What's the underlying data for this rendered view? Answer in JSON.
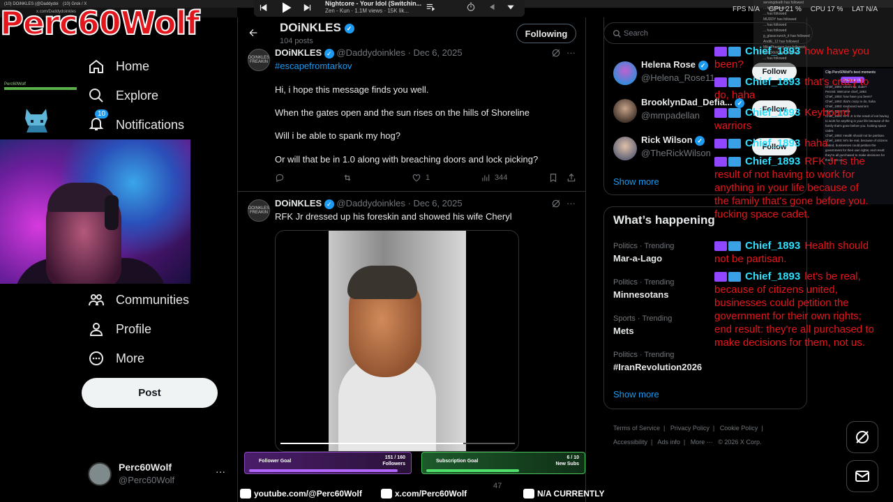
{
  "browser": {
    "tabs": [
      "(10) DOiNKLES (@Daddydoinkles)",
      "(10) Grok / X"
    ],
    "url": "x.com/Daddydoinkles"
  },
  "stream": {
    "logo_text": "Perc60Wolf",
    "mini_bar_label": "Perc60Wolf",
    "stats": [
      "FPS N/A",
      "GPU 21 %",
      "CPU 17 %",
      "LAT N/A"
    ],
    "events": [
      "servingdeath  has followed",
      "...  has followed",
      "...  has followed",
      "MUDDY  has followed",
      "...  has followed",
      "...  has followed",
      "g_glasscrunch_it  has followed",
      "AndiE_12  has followed",
      "MikePhantom  has followed",
      "SNICKER  has followed",
      "...  has followed"
    ],
    "clip_box": {
      "title": "Clip Perc60Wolf's best moments",
      "button": "Create a Clip",
      "lines": [
        "Chief_1893: what's up, dude?",
        "Perc60: Welcome chief_1893",
        "Chief_1893: how have you been?",
        "Chief_1893: that's crazy to do, haha",
        "Chief_1893: Keyboard warriors",
        "Chief_1893: haha",
        "Chief_1893: RFK Jr is the result of not having to work for anything in your life because of the family that's gone before you. fucking space cadet.",
        "Chief_1893: Health should not be partisan.",
        "Chief_1893: let's be real, because of citizens united, businesses could petition the government for their own rights; end result: they're all purchased to make decisions for them, not us."
      ]
    },
    "chat": [
      {
        "user": "Chief_1893",
        "msg": "how have you been?"
      },
      {
        "user": "Chief_1893",
        "msg": "that's crazy to do, haha"
      },
      {
        "user": "Chief_1893",
        "msg": "Keyboard warriors"
      },
      {
        "user": "Chief_1893",
        "msg": "haha"
      },
      {
        "user": "Chief_1893",
        "msg": "RFK Jr is the result of not having to work for anything in your life because of the family that's gone before you. fucking space cadet."
      },
      {
        "user": "Chief_1893",
        "msg": "Health should not be partisan."
      },
      {
        "user": "Chief_1893",
        "msg": "let's be real, because of citizens united, businesses could petition the government for their own rights; end result: they're all purchased to make decisions for them, not us."
      }
    ],
    "follower_goal": {
      "label": "Follower Goal",
      "value": "151 / 160",
      "unit": "Followers",
      "fraction": 0.944
    },
    "sub_goal": {
      "label": "Subscription Goal",
      "value": "6 / 10",
      "unit": "New Subs",
      "fraction": 0.6
    },
    "social": {
      "youtube": "youtube.com/@Perc60Wolf",
      "x": "x.com/Perc60Wolf",
      "facebook": "N/A CURRENTLY"
    },
    "media": {
      "title": "Nightcore - Your Idol (Switchin...",
      "meta": "Zen - Kun · 1.1M views · 15K lik..."
    }
  },
  "nav": {
    "items": [
      {
        "label": "Home",
        "icon": "home-icon"
      },
      {
        "label": "Explore",
        "icon": "search-icon"
      },
      {
        "label": "Notifications",
        "icon": "bell-icon",
        "badge": "10"
      },
      {
        "label": "Communities",
        "icon": "communities-icon"
      },
      {
        "label": "Profile",
        "icon": "profile-icon"
      },
      {
        "label": "More",
        "icon": "more-circle-icon"
      }
    ],
    "post_label": "Post",
    "account": {
      "name": "Perc60Wolf",
      "handle": "@Perc60Wolf",
      "menu": "···"
    }
  },
  "profile_header": {
    "name": "DOiNKLES",
    "posts": "104 posts",
    "following_label": "Following"
  },
  "tweets": [
    {
      "author": "DOiNKLES",
      "handle": "@Daddydoinkles",
      "date": "· Dec 6, 2025",
      "avatar_text": "DOINKLES FREAKIN",
      "hashtag": "#escapefromtarkov",
      "lines": [
        "Hi, i hope this message finds you well.",
        "When the gates open and the sun rises on the hills of Shoreline",
        "Will i be able to spank my hog?",
        "Or will that be in 1.0 along with breaching  doors and lock picking?"
      ],
      "likes": "1",
      "views": "344"
    },
    {
      "author": "DOiNKLES",
      "handle": "@Daddydoinkles",
      "date": "· Dec 6, 2025",
      "avatar_text": "DOINKLES FREAKIN",
      "lines": [
        "RFK Jr dressed up his foreskin and showed his wife Cheryl"
      ],
      "likes": "47",
      "views": ""
    }
  ],
  "sidebar": {
    "search_placeholder": "Search",
    "who_to_follow": [
      {
        "name": "Helena Rose",
        "handle": "@Helena_Rose11",
        "follow": "Follow"
      },
      {
        "name": "BrooklynDad_Defia...",
        "handle": "@mmpadellan",
        "follow": "Follow"
      },
      {
        "name": "Rick Wilson",
        "handle": "@TheRickWilson",
        "follow": "Follow"
      }
    ],
    "show_more": "Show more",
    "trending_title": "What’s happening",
    "trends": [
      {
        "context": "Politics · Trending",
        "name": "Mar-a-Lago"
      },
      {
        "context": "Politics · Trending",
        "name": "Minnesotans"
      },
      {
        "context": "Sports · Trending",
        "name": "Mets"
      },
      {
        "context": "Politics · Trending",
        "name": "#IranRevolution2026"
      }
    ],
    "footer": [
      "Terms of Service",
      "|",
      "Privacy Policy",
      "|",
      "Cookie Policy",
      "|",
      "Accessibility",
      "|",
      "Ads info",
      "|",
      "More ···",
      "© 2026 X Corp."
    ]
  },
  "colors": {
    "accent": "#1d9bf0",
    "chat_text": "#e8151b",
    "chat_user": "#2ee0ff",
    "twitch": "#9146ff"
  }
}
